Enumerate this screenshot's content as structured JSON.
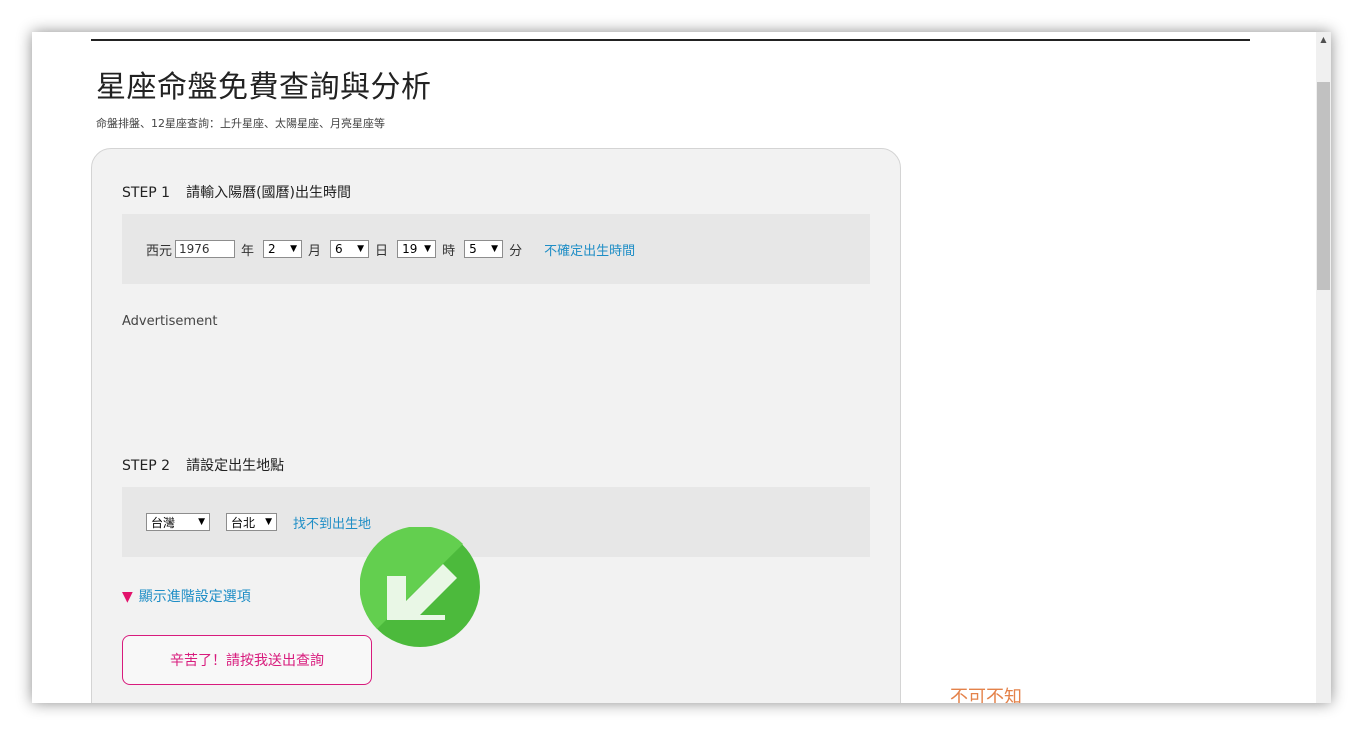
{
  "header": {
    "title": "星座命盤免費查詢與分析",
    "subtitle": "命盤排盤、12星座查詢：上升星座、太陽星座、月亮星座等"
  },
  "step1": {
    "number": "STEP 1",
    "title": "請輸入陽曆(國曆)出生時間",
    "era_label": "西元",
    "year_value": "1976",
    "year_unit": "年",
    "month_value": "2",
    "month_unit": "月",
    "day_value": "6",
    "day_unit": "日",
    "hour_value": "19",
    "hour_unit": "時",
    "minute_value": "5",
    "minute_unit": "分",
    "unsure_time_link": "不確定出生時間"
  },
  "advertisement_label": "Advertisement",
  "step2": {
    "number": "STEP 2",
    "title": "請設定出生地點",
    "country_value": "台灣",
    "city_value": "台北",
    "not_found_link": "找不到出生地"
  },
  "advanced_toggle": {
    "marker": "▼",
    "label": "顯示進階設定選項"
  },
  "submit_label": "辛苦了！請按我送出查詢",
  "side_link": "不可不知",
  "icons": {
    "dropdown": "triangle-down",
    "overlay": "green-circle-arrow-down-left",
    "scroll_up": "triangle-up"
  },
  "colors": {
    "accent_blue": "#1f8ec6",
    "accent_pink": "#d81b7d",
    "arrow_green": "#4cba3c",
    "side_link_orange": "#e4824a"
  }
}
